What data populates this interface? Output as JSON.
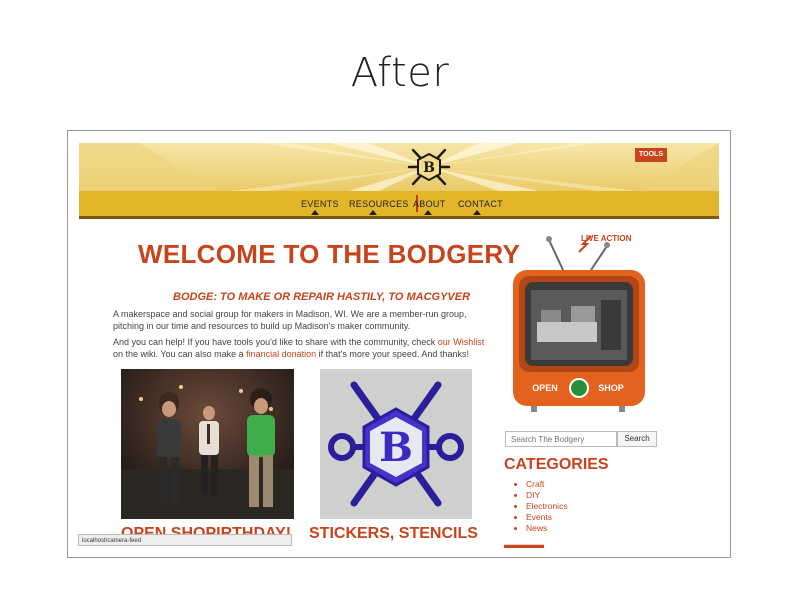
{
  "caption": "After",
  "header": {
    "tools_label": "TOOLS",
    "logo_letter": "B"
  },
  "nav": {
    "items": [
      {
        "label": "EVENTS"
      },
      {
        "label": "RESOURCES"
      },
      {
        "label": "ABOUT"
      },
      {
        "label": "CONTACT"
      }
    ]
  },
  "main": {
    "title": "WELCOME TO THE BODGERY",
    "subtitle": "BODGE: TO MAKE OR REPAIR HASTILY, TO MACGYVER",
    "para1": "A makerspace and social group for makers in Madison, WI. We are a member-run group, pitching in our time and resources to build up Madison's maker community.",
    "para2_before": "And you can help! If you have tools you'd like to share with the community, check ",
    "para2_link1": "our Wishlist",
    "para2_mid": " on the wiki. You can also make a ",
    "para2_link2": "financial donation",
    "para2_after": " if that's more your speed. And thanks!",
    "cards": [
      {
        "title": "OPEN SHOPIRTHDAY!"
      },
      {
        "title": "STICKERS, STENCILS"
      }
    ]
  },
  "status_bar": "localhost/camera-feed",
  "sidebar": {
    "tv": {
      "live_label": "LIVE ACTION",
      "open_label": "OPEN",
      "shop_label": "SHOP"
    },
    "search": {
      "placeholder": "Search The Bodgery",
      "button_label": "Search"
    },
    "categories_title": "CATEGORIES",
    "categories": [
      "Craft",
      "DIY",
      "Electronics",
      "Events",
      "News"
    ]
  },
  "colors": {
    "accent": "#c8441c",
    "nav_yellow": "#e2b628",
    "header_cream": "#f3dc8a"
  }
}
